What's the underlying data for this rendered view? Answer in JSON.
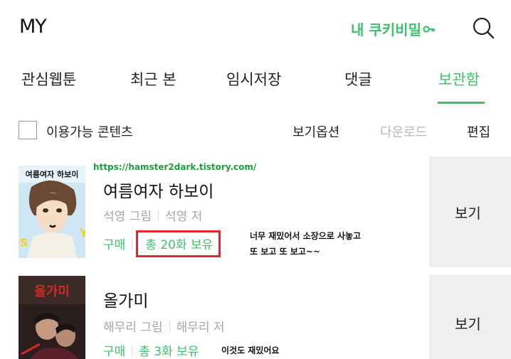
{
  "header": {
    "title": "MY",
    "cookie_link": "내 쿠키비밀",
    "cookie_icon": "key-icon",
    "search_icon": "search-icon"
  },
  "tabs": [
    {
      "label": "관심웹툰",
      "active": false
    },
    {
      "label": "최근 본",
      "active": false
    },
    {
      "label": "임시저장",
      "active": false
    },
    {
      "label": "댓글",
      "active": false
    },
    {
      "label": "보관함",
      "active": true
    }
  ],
  "options": {
    "available_only": "이용가능 콘텐츠",
    "view_options": "보기옵션",
    "download": "다운로드",
    "edit": "편집"
  },
  "colors": {
    "accent": "#3ec16a",
    "disabled": "#b8b8b8",
    "highlight_box": "#e3262c",
    "view_button_bg": "#efefef"
  },
  "watermark": "https://hamster2dark.tistory.com/",
  "items": [
    {
      "title": "여름여자 하보이",
      "artist": "석영 그림",
      "writer": "석영 저",
      "purchase": "구매",
      "owned": "총 20화 보유",
      "view": "보기",
      "note_line1": "너무 재밌어서 소장으로 사놓고",
      "note_line2": "또 보고 또 보고~~",
      "thumb_text": "여름여자 하보이"
    },
    {
      "title": "올가미",
      "artist": "해무리 그림",
      "writer": "해무리 저",
      "purchase": "구매",
      "owned": "총 3화 보유",
      "view": "보기",
      "note_line1": "이것도 재밌어요",
      "thumb_text": "올가미"
    }
  ]
}
